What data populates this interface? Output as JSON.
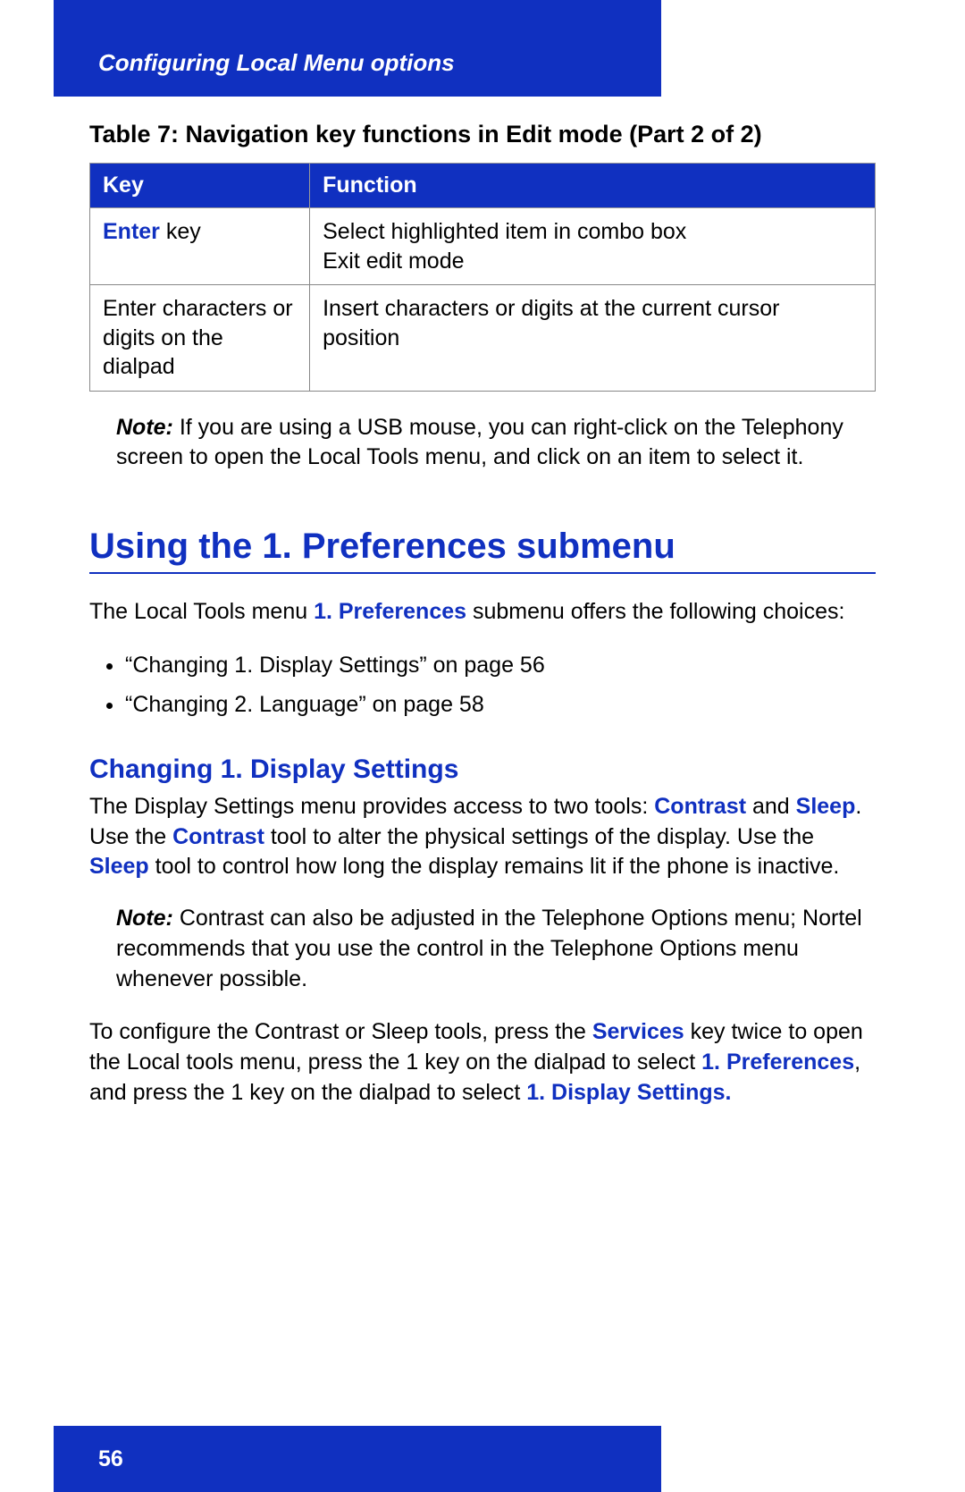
{
  "header": {
    "title": "Configuring Local Menu options"
  },
  "table": {
    "caption": "Table 7: Navigation key functions in Edit mode (Part 2 of 2)",
    "headers": {
      "key": "Key",
      "function": "Function"
    },
    "rows": [
      {
        "key_strong": "Enter",
        "key_rest": " key",
        "func_line1": "Select highlighted item in combo box",
        "func_line2": "Exit edit mode"
      },
      {
        "key_plain": "Enter characters or digits on the dialpad",
        "func_line1": "Insert characters or digits at the current cursor position"
      }
    ]
  },
  "note1": {
    "label": "Note:",
    "text": " If you are using a USB mouse, you can right-click on the Telephony screen to open the Local Tools menu, and click on an item to select it."
  },
  "section": {
    "heading": "Using the 1. Preferences submenu",
    "intro_pre": "The Local Tools menu ",
    "intro_strong": "1. Preferences",
    "intro_post": " submenu offers the following choices:",
    "bullets": [
      "“Changing 1. Display Settings” on page 56",
      "“Changing 2. Language” on page 58"
    ]
  },
  "subsection": {
    "heading": "Changing 1. Display Settings",
    "p1": {
      "t1": "The Display Settings menu provides access to two tools: ",
      "s1": "Contrast",
      "t2": " and ",
      "s2": "Sleep",
      "t3": ". Use the ",
      "s3": "Contrast",
      "t4": " tool to alter the physical settings of the display. Use the ",
      "s4": "Sleep",
      "t5": " tool to control how long the display remains lit if the phone is inactive."
    },
    "note2": {
      "label": "Note:",
      "text": " Contrast can also be adjusted in the Telephone Options menu; Nortel recommends that you use the control in the Telephone Options menu whenever possible."
    },
    "p2": {
      "t1": "To configure the Contrast or Sleep tools, press the ",
      "s1": "Services",
      "t2": " key twice to open the Local tools menu, press the 1 key on the dialpad to select ",
      "s2": "1. Preferences",
      "t3": ", and press the 1 key on the dialpad to select ",
      "s3": "1. Display Settings."
    }
  },
  "footer": {
    "page": "56"
  }
}
